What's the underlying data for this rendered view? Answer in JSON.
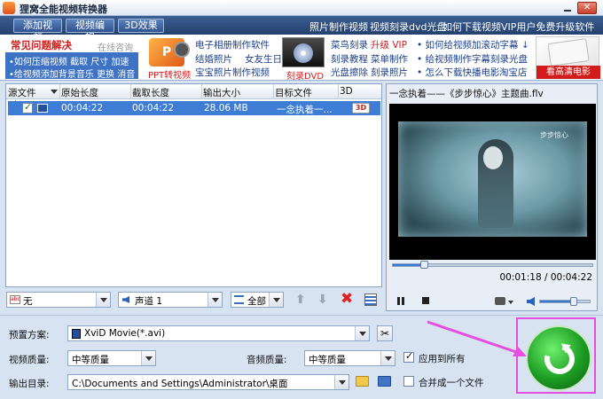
{
  "window": {
    "title": "狸窝全能视频转换器"
  },
  "nav": {
    "buttons": [
      "添加视频",
      "视频编辑",
      "3D效果"
    ],
    "links": [
      "照片制作视频",
      "视频刻录dvd光盘",
      "如何下载视频",
      "VIP用户免费升级软件"
    ]
  },
  "banner": {
    "faq_title": "常见问题解决",
    "online": "在线咨询",
    "faq1": [
      "如何压缩视频",
      "截取",
      "尺寸",
      "加速"
    ],
    "faq2": [
      "给视频添加背景音乐",
      "更换",
      "消音"
    ],
    "ppt_label": "PPT转视频",
    "album": [
      "电子相册制作软件",
      "结婚照片",
      "女友生日",
      "宝宝照片制作视频"
    ],
    "dvd_label": "刻录DVD",
    "burn": [
      "菜鸟刻录",
      "升级 VIP",
      "刻录教程",
      "菜单制作",
      "光盘擦除",
      "刻录照片"
    ],
    "tips": [
      "如何给视频加滚动字幕",
      "给视频制作字幕刻录光盘",
      "怎么下载快播电影",
      "淘宝店"
    ],
    "hd_label": "看高清电影"
  },
  "list": {
    "headers": [
      "源文件",
      "原始长度",
      "截取长度",
      "输出大小",
      "目标文件",
      "3D"
    ],
    "rows": [
      {
        "orig": "00:04:22",
        "cut": "00:04:22",
        "size": "28.06 MB",
        "target": "一念执着一...",
        "badge": "3D"
      }
    ]
  },
  "list_toolbar": {
    "subtitle": "无",
    "audio": "声道 1",
    "select": "全部"
  },
  "preview": {
    "title": "一念执着——《步步惊心》主题曲.flv",
    "time": "00:01:18 / 00:04:22",
    "seek_progress": 0.16,
    "volume": 0.7,
    "overlay_text": "步步惊心"
  },
  "settings": {
    "preset_label": "预置方案:",
    "preset_value": "XviD Movie(*.avi)",
    "video_label": "视频质量:",
    "video_value": "中等质量",
    "audio_label": "音频质量:",
    "audio_value": "中等质量",
    "apply_all": "应用到所有",
    "output_label": "输出目录:",
    "output_value": "C:\\Documents and Settings\\Administrator\\桌面",
    "merge": "合并成一个文件"
  },
  "colors": {
    "nav": "#2c4c7f",
    "selected_row": "#3d7dd6",
    "convert": "#22a02a",
    "highlight": "#e64ee0"
  }
}
